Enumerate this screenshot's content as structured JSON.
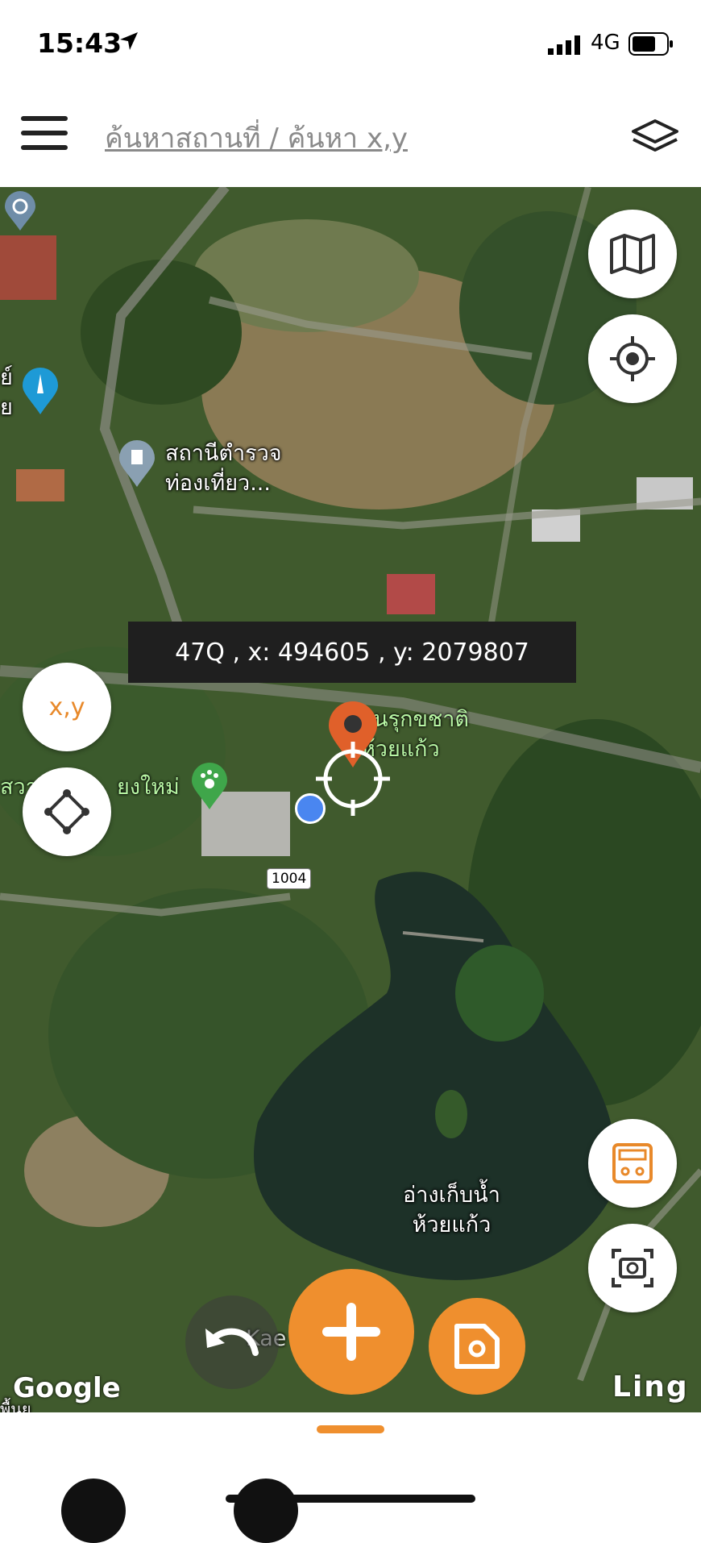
{
  "status_bar": {
    "time": "15:43",
    "network": "4G",
    "icons": [
      "location-arrow-icon",
      "signal-icon",
      "battery-icon"
    ]
  },
  "search": {
    "placeholder": "ค้นหาสถานที่ / ค้นหา x,y"
  },
  "coordinates": {
    "text": "47Q , x: 494605 , y: 2079807"
  },
  "map": {
    "labels": {
      "police": "สถานีตำรวจ\nท่องเที่ยว...",
      "park": "วนรุกขชาติ\nห้วยแก้ว",
      "zoo_partial": "สวา",
      "zoo_partial2": "ยงใหม่",
      "reservoir": "อ่างเก็บน้ำ\nห้วยแก้ว",
      "left_edge": "ย์\nย",
      "bottom_partial": "Kae",
      "bottom_left": "พื้นย"
    },
    "route_shield": "1004",
    "attribution": "Google",
    "brand": "Ling"
  },
  "buttons": {
    "xy": "x,y",
    "map_type_icon": "map-icon",
    "locate_icon": "target-icon",
    "shape_icon": "polygon-icon",
    "calc_icon": "calculator-icon",
    "screenshot_icon": "camera-icon",
    "add_icon": "plus-icon",
    "save_icon": "save-icon",
    "undo_icon": "undo-icon"
  },
  "colors": {
    "accent": "#ef8f2e",
    "coord_bg": "#1f1f1f"
  }
}
